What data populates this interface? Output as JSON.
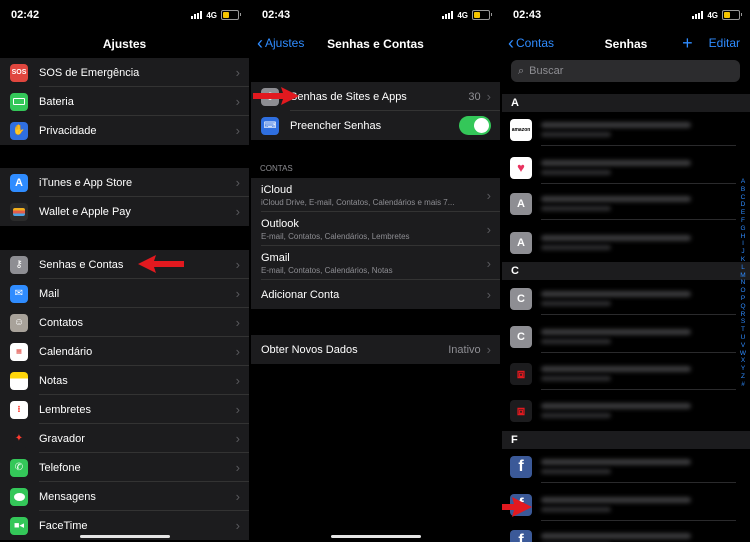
{
  "status": {
    "p1_time": "02:42",
    "p2_time": "02:43",
    "p3_time": "02:43",
    "network": "4G"
  },
  "panel1": {
    "title": "Ajustes",
    "group1": [
      {
        "label": "SOS de Emergência",
        "icon": "sos-icon",
        "icon_text": "SOS",
        "color": "#e0463e"
      },
      {
        "label": "Bateria",
        "icon": "battery-icon",
        "color": "#34c759"
      },
      {
        "label": "Privacidade",
        "icon": "hand-icon",
        "color": "#2f6fe0"
      }
    ],
    "group2": [
      {
        "label": "iTunes e App Store",
        "icon": "app-store-icon",
        "color": "#2f8cff"
      },
      {
        "label": "Wallet e Apple Pay",
        "icon": "wallet-icon",
        "color": "#2b2b2b"
      }
    ],
    "group3": [
      {
        "label": "Senhas e Contas",
        "icon": "key-icon",
        "color": "#8e8e93"
      },
      {
        "label": "Mail",
        "icon": "mail-icon",
        "color": "#2f8cff"
      },
      {
        "label": "Contatos",
        "icon": "contacts-icon",
        "color": "#a8a29a"
      },
      {
        "label": "Calendário",
        "icon": "calendar-icon",
        "color": "#ffffff"
      },
      {
        "label": "Notas",
        "icon": "notes-icon",
        "color": "#ffd60a"
      },
      {
        "label": "Lembretes",
        "icon": "reminders-icon",
        "color": "#ffffff"
      },
      {
        "label": "Gravador",
        "icon": "voice-memo-icon",
        "color": "#1c1c1e"
      },
      {
        "label": "Telefone",
        "icon": "phone-icon",
        "color": "#34c759"
      },
      {
        "label": "Mensagens",
        "icon": "messages-icon",
        "color": "#34c759"
      },
      {
        "label": "FaceTime",
        "icon": "facetime-icon",
        "color": "#34c759"
      }
    ]
  },
  "panel2": {
    "back": "Ajustes",
    "title": "Senhas e Contas",
    "site_passwords": {
      "label": "Senhas de Sites e Apps",
      "count": "30"
    },
    "autofill": {
      "label": "Preencher Senhas",
      "enabled": true
    },
    "contas_header": "CONTAS",
    "accounts": [
      {
        "name": "iCloud",
        "detail": "iCloud Drive, E-mail, Contatos, Calendários e mais 7..."
      },
      {
        "name": "Outlook",
        "detail": "E-mail, Contatos, Calendários, Lembretes"
      },
      {
        "name": "Gmail",
        "detail": "E-mail, Contatos, Calendários, Notas"
      }
    ],
    "add_account": "Adicionar Conta",
    "fetch": {
      "label": "Obter Novos Dados",
      "value": "Inativo"
    }
  },
  "panel3": {
    "back": "Contas",
    "title": "Senhas",
    "edit": "Editar",
    "search_placeholder": "Buscar",
    "sections": [
      {
        "letter": "A",
        "items": [
          {
            "icon": "amazon-icon",
            "icon_text": "amazon"
          },
          {
            "icon": "heart-icon",
            "icon_text": ""
          },
          {
            "icon": "letter-a-icon",
            "icon_text": "A"
          },
          {
            "icon": "letter-a-icon",
            "icon_text": "A"
          }
        ]
      },
      {
        "letter": "C",
        "items": [
          {
            "icon": "letter-c-icon",
            "icon_text": "C"
          },
          {
            "icon": "letter-c-icon",
            "icon_text": "C"
          },
          {
            "icon": "gift-icon",
            "icon_text": ""
          },
          {
            "icon": "gift-icon",
            "icon_text": ""
          }
        ]
      },
      {
        "letter": "F",
        "items": [
          {
            "icon": "facebook-icon",
            "icon_text": "f"
          },
          {
            "icon": "facebook-icon",
            "icon_text": "f"
          },
          {
            "icon": "facebook-icon",
            "icon_text": "f"
          }
        ]
      }
    ],
    "index": [
      "A",
      "B",
      "C",
      "D",
      "E",
      "F",
      "G",
      "H",
      "I",
      "J",
      "K",
      "L",
      "M",
      "N",
      "O",
      "P",
      "Q",
      "R",
      "S",
      "T",
      "U",
      "V",
      "W",
      "X",
      "Y",
      "Z",
      "#"
    ]
  }
}
